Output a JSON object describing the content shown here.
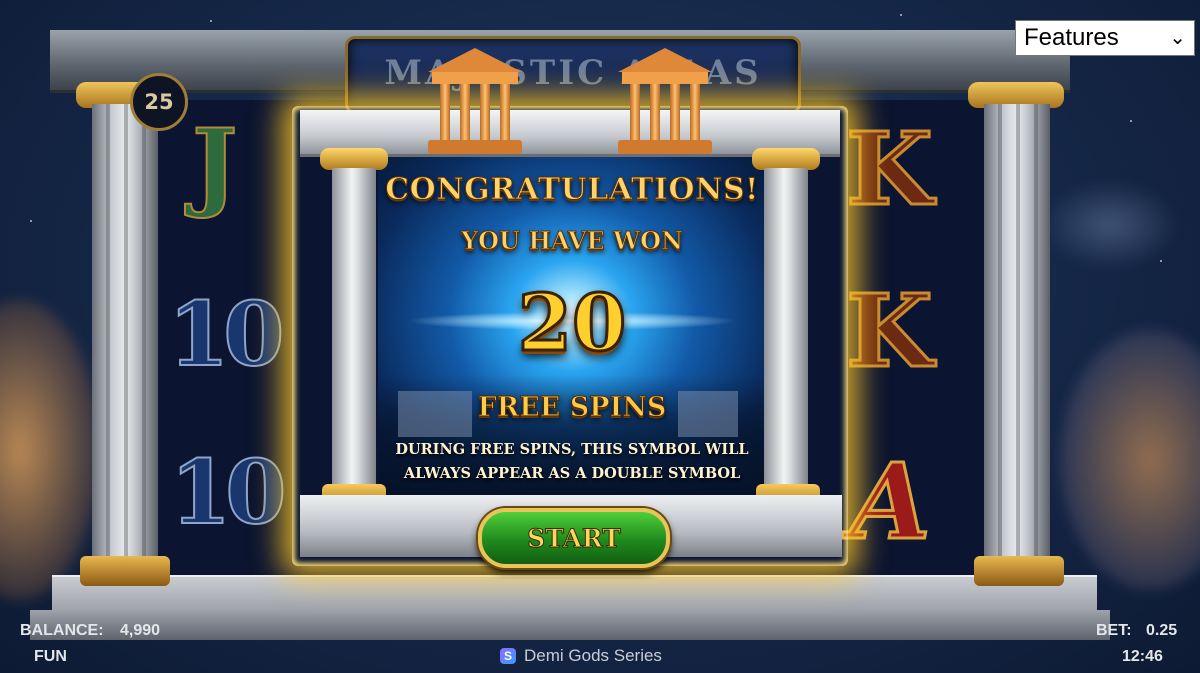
{
  "game": {
    "logo_text": "MAJESTIC ATLAS",
    "bet_lines": "25"
  },
  "features_select": {
    "selected": "Features"
  },
  "reels": {
    "left_symbols": [
      "J",
      "10",
      "10"
    ],
    "right_symbols": [
      "K",
      "K",
      "A"
    ]
  },
  "popup": {
    "congrats": "CONGRATULATIONS!",
    "you_have_won": "YOU HAVE WON",
    "spins_count": "20",
    "free_spins": "FREE SPINS",
    "description_line1": "DURING FREE SPINS, THIS SYMBOL WILL",
    "description_line2": "ALWAYS APPEAR AS A DOUBLE SYMBOL",
    "start_label": "START"
  },
  "bottom_bar": {
    "balance_label": "BALANCE:",
    "balance_value": "4,990",
    "mode": "FUN",
    "series_name": "Demi Gods Series",
    "bet_label": "BET:",
    "bet_value": "0.25",
    "time": "12:46"
  },
  "colors": {
    "accent_gold": "#ffd36a",
    "start_green": "#1f8a1c",
    "glow": "#ffc828"
  }
}
